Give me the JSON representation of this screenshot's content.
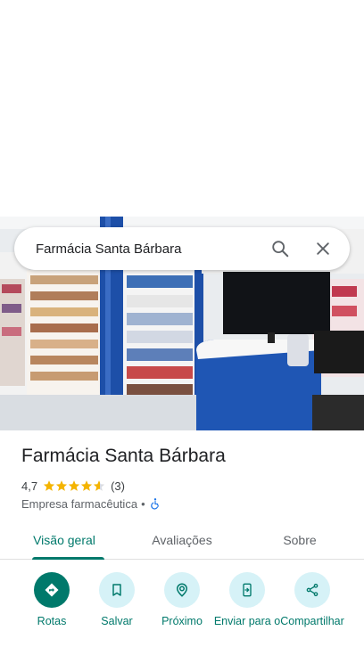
{
  "search": {
    "query": "Farmácia Santa Bárbara"
  },
  "icons": {
    "search": "search-icon",
    "close": "close-icon",
    "wheelchair": "wheelchair-accessible-icon",
    "directions": "directions-icon",
    "save": "bookmark-icon",
    "nearby": "nearby-icon",
    "send": "send-to-phone-icon",
    "share": "share-icon"
  },
  "place": {
    "name": "Farmácia Santa Bárbara",
    "rating": "4,7",
    "rating_value": 4.7,
    "review_count": "(3)",
    "category": "Empresa farmacêutica",
    "separator": "•"
  },
  "tabs": [
    {
      "label": "Visão geral",
      "active": true
    },
    {
      "label": "Avaliações",
      "active": false
    },
    {
      "label": "Sobre",
      "active": false
    }
  ],
  "actions": [
    {
      "label": "Rotas"
    },
    {
      "label": "Salvar"
    },
    {
      "label": "Próximo"
    },
    {
      "label": "Enviar para o"
    },
    {
      "label": "Compartilhar"
    }
  ],
  "colors": {
    "accent": "#00796b",
    "action_bg": "#d6f2f7",
    "star": "#f4b400"
  }
}
